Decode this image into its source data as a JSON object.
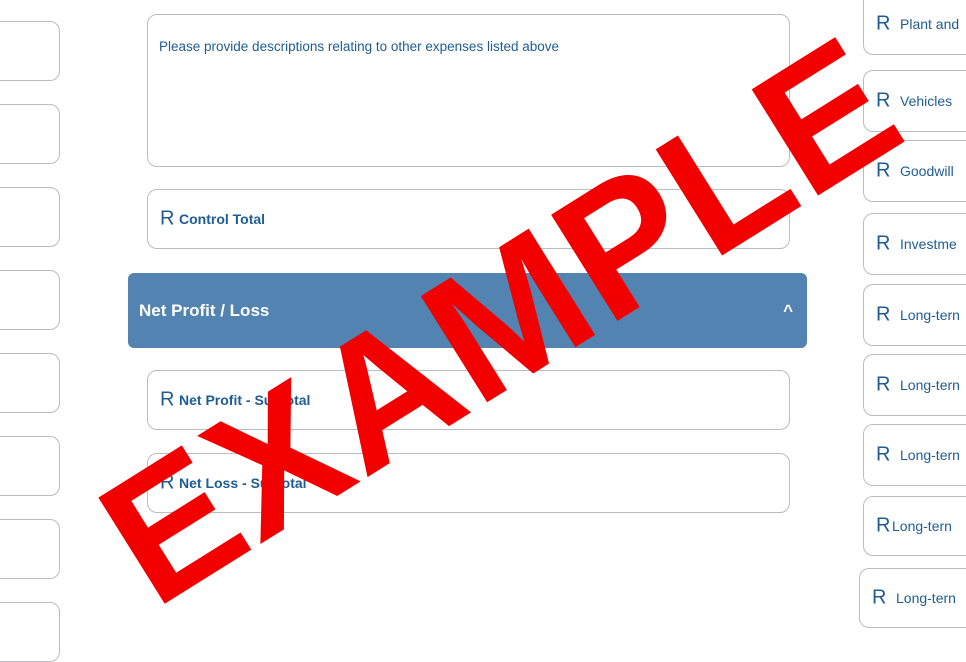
{
  "other_expenses": {
    "placeholder": "Please provide descriptions relating to other expenses listed above"
  },
  "currency_symbol": "R",
  "control_total": {
    "label": "Control Total"
  },
  "section": {
    "title": "Net Profit / Loss",
    "toggle": "^"
  },
  "net_fields": [
    {
      "label": "Net Profit - Subtotal"
    },
    {
      "label": "Net Loss - Subtotal"
    }
  ],
  "right_column": [
    {
      "label": "Plant and"
    },
    {
      "label": "Vehicles"
    },
    {
      "label": "Goodwill"
    },
    {
      "label": "Investme"
    },
    {
      "label": "Long-tern"
    },
    {
      "label": "Long-tern"
    },
    {
      "label": "Long-tern"
    },
    {
      "label": "Long-tern"
    },
    {
      "label": "Long-tern"
    }
  ],
  "watermark": {
    "text": "EXAMPLE",
    "color": "#f20000"
  }
}
